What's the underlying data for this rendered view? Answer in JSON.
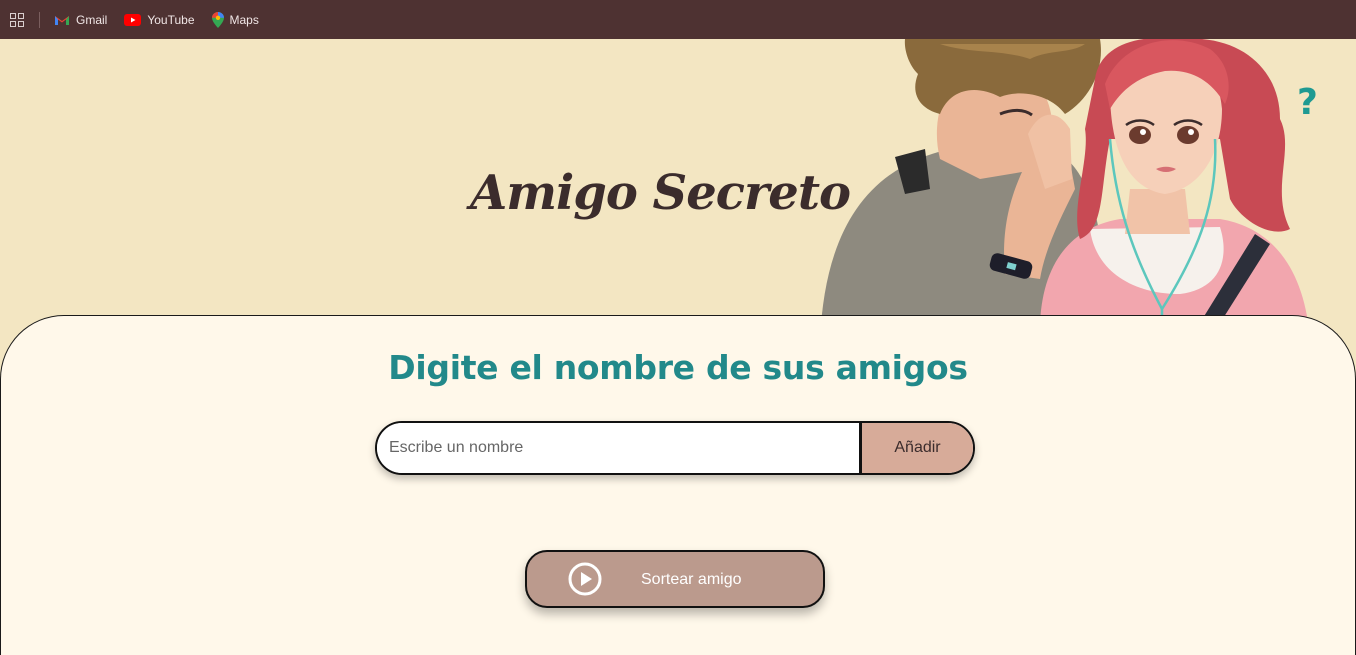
{
  "bookmarks": {
    "items": [
      {
        "label": "Gmail",
        "icon": "gmail-icon"
      },
      {
        "label": "YouTube",
        "icon": "youtube-icon"
      },
      {
        "label": "Maps",
        "icon": "maps-icon"
      }
    ]
  },
  "header": {
    "title": "Amigo Secreto",
    "illustration": "illustration of two friends whispering"
  },
  "main": {
    "subtitle": "Digite el nombre de sus amigos",
    "input": {
      "placeholder": "Escribe un nombre",
      "value": ""
    },
    "add_label": "Añadir",
    "draw_label": "Sortear amigo"
  },
  "colors": {
    "bookmarks_bar": "#4e3232",
    "header_bg": "#f3e6c2",
    "main_bg": "#fff8ea",
    "subtitle": "#22898a",
    "add_button": "#d7ab99",
    "draw_button": "#bb9a8d"
  }
}
